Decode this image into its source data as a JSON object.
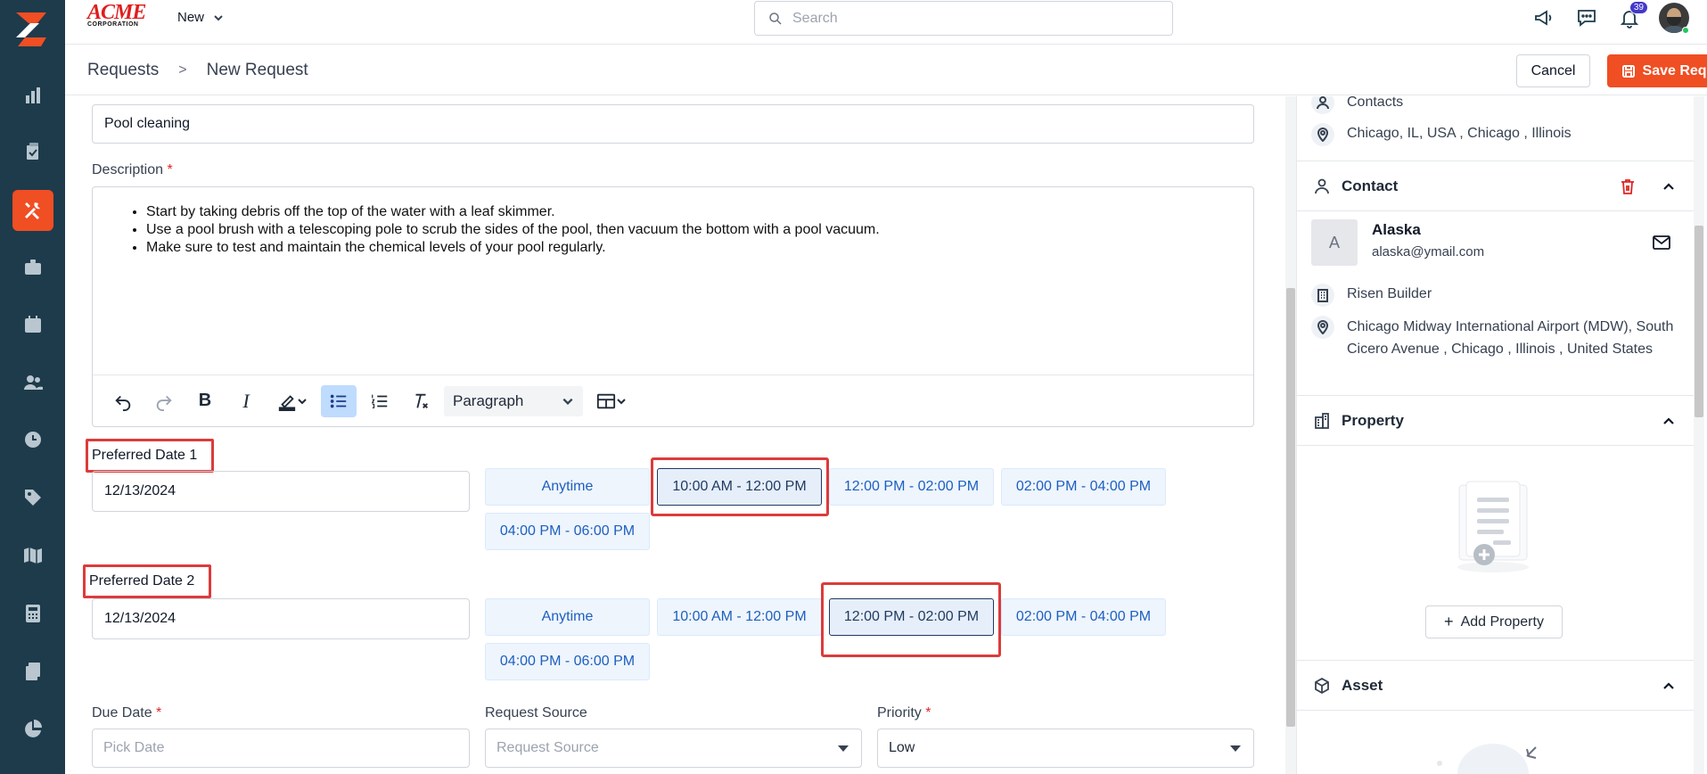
{
  "topbar": {
    "brand_name": "ACME",
    "brand_sub": "CORPORATION",
    "new_label": "New",
    "search_placeholder": "Search",
    "notification_count": "39"
  },
  "subheader": {
    "crumb_root": "Requests",
    "crumb_sep": ">",
    "crumb_current": "New Request",
    "cancel_label": "Cancel",
    "save_label": "Save Request"
  },
  "form": {
    "title_value": "Pool cleaning",
    "description_label": "Description",
    "required_mark": "*",
    "description_items": [
      "Start by taking debris off the top of the water with a leaf skimmer.",
      "Use a pool brush with a telescoping pole to scrub the sides of the pool, then vacuum the bottom with a pool vacuum.",
      "Make sure to test and maintain the chemical levels of your pool regularly."
    ],
    "toolbar": {
      "paragraph_label": "Paragraph"
    },
    "preferred_date_1": {
      "label": "Preferred Date 1",
      "value": "12/13/2024",
      "slots": [
        "Anytime",
        "10:00 AM - 12:00 PM",
        "12:00 PM - 02:00 PM",
        "02:00 PM - 04:00 PM",
        "04:00 PM - 06:00 PM"
      ],
      "selected_slot": "10:00 AM - 12:00 PM"
    },
    "preferred_date_2": {
      "label": "Preferred Date 2",
      "value": "12/13/2024",
      "slots": [
        "Anytime",
        "10:00 AM - 12:00 PM",
        "12:00 PM - 02:00 PM",
        "02:00 PM - 04:00 PM",
        "04:00 PM - 06:00 PM"
      ],
      "selected_slot": "12:00 PM - 02:00 PM"
    },
    "due_date": {
      "label": "Due Date",
      "placeholder": "Pick Date"
    },
    "request_source": {
      "label": "Request Source",
      "placeholder": "Request Source"
    },
    "priority": {
      "label": "Priority",
      "value": "Low"
    }
  },
  "right_panel": {
    "contacts_row": "Contacts",
    "client_address": "Chicago, IL, USA , Chicago , Illinois",
    "contact_section": "Contact",
    "contact_initial": "A",
    "contact_name": "Alaska",
    "contact_email": "alaska@ymail.com",
    "contact_company": "Risen Builder",
    "contact_address": "Chicago Midway International Airport (MDW), South Cicero Avenue , Chicago , Illinois , United States",
    "property_section": "Property",
    "add_property_label": "Add Property",
    "asset_section": "Asset"
  },
  "colors": {
    "accent": "#f04e23",
    "rail": "#1d3b4b",
    "highlight": "#dc3b3b",
    "slot_text": "#1e5fbf"
  }
}
